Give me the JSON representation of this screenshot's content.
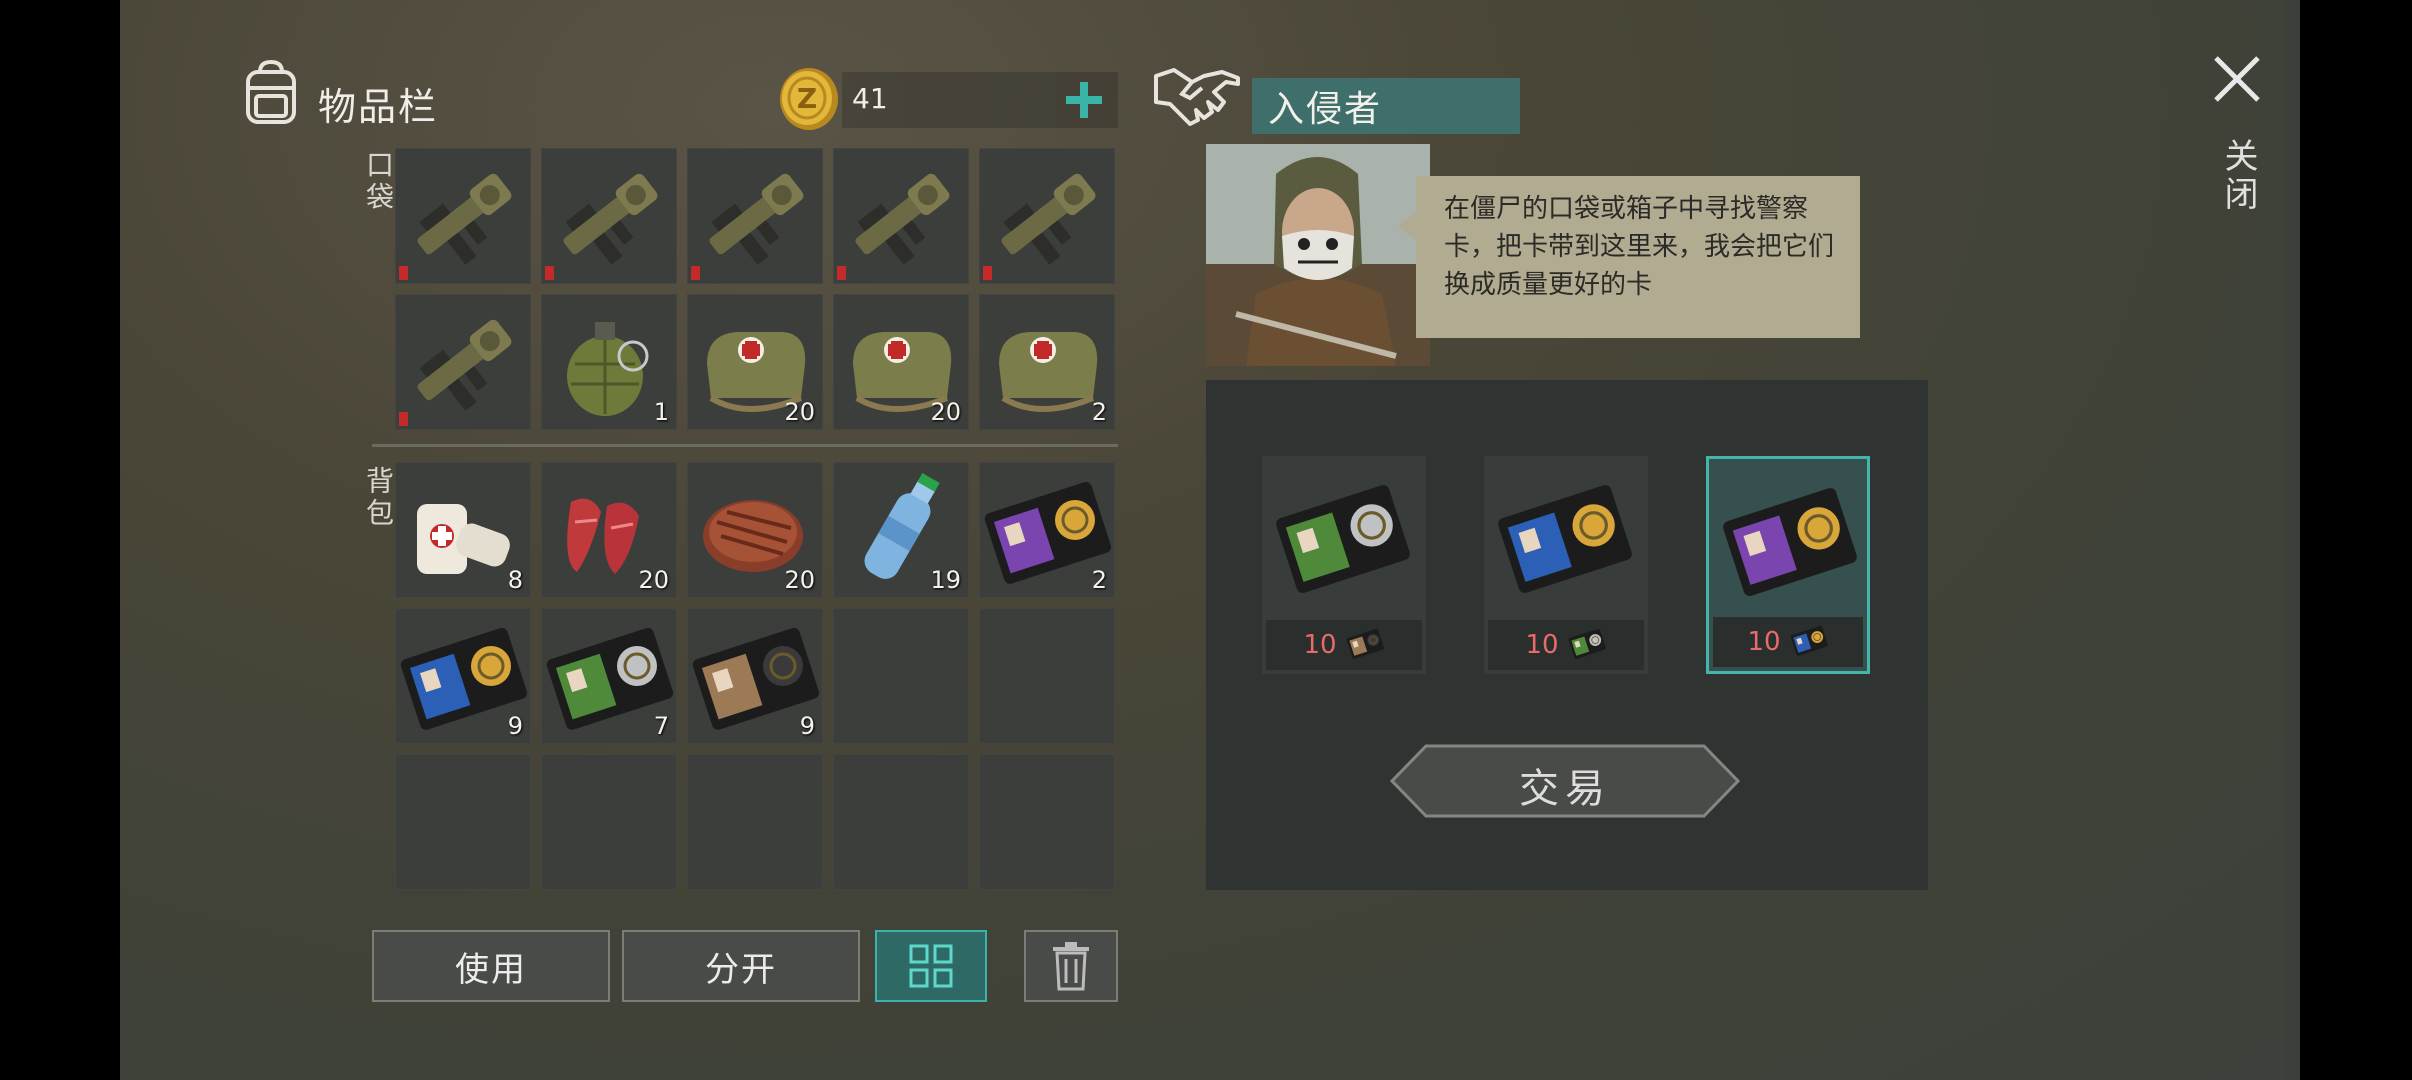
{
  "inventory": {
    "title": "物品栏",
    "coins": "41",
    "pocket_label": "口袋",
    "backpack_label": "背包",
    "pocket_slots": [
      {
        "item": "grenade-launcher",
        "qty": "",
        "damaged": true
      },
      {
        "item": "grenade-launcher",
        "qty": "",
        "damaged": true
      },
      {
        "item": "grenade-launcher",
        "qty": "",
        "damaged": true
      },
      {
        "item": "grenade-launcher",
        "qty": "",
        "damaged": true
      },
      {
        "item": "grenade-launcher",
        "qty": "",
        "damaged": true
      },
      {
        "item": "grenade-launcher",
        "qty": "",
        "damaged": true
      },
      {
        "item": "frag-grenade",
        "qty": "1",
        "damaged": false
      },
      {
        "item": "medkit-bag",
        "qty": "20",
        "damaged": false
      },
      {
        "item": "medkit-bag",
        "qty": "20",
        "damaged": false
      },
      {
        "item": "medkit-bag",
        "qty": "2",
        "damaged": false
      }
    ],
    "backpack_slots": [
      {
        "item": "bandage",
        "qty": "8"
      },
      {
        "item": "raw-meat",
        "qty": "20"
      },
      {
        "item": "steak",
        "qty": "20"
      },
      {
        "item": "water-bottle",
        "qty": "19"
      },
      {
        "item": "police-card-purple",
        "qty": "2"
      },
      {
        "item": "police-card-blue",
        "qty": "9"
      },
      {
        "item": "police-card-green",
        "qty": "7"
      },
      {
        "item": "police-card-brown",
        "qty": "9"
      },
      {
        "item": "",
        "qty": ""
      },
      {
        "item": "",
        "qty": ""
      },
      {
        "item": "",
        "qty": ""
      },
      {
        "item": "",
        "qty": ""
      },
      {
        "item": "",
        "qty": ""
      },
      {
        "item": "",
        "qty": ""
      },
      {
        "item": "",
        "qty": ""
      }
    ],
    "buttons": {
      "use": "使用",
      "split": "分开"
    }
  },
  "trader": {
    "name": "入侵者",
    "speech": "在僵尸的口袋或箱子中寻找警察卡，把卡带到这里来，我会把它们换成质量更好的卡",
    "offers": [
      {
        "card": "police-card-green",
        "cost": "10",
        "cost_card": "police-card-brown",
        "selected": false
      },
      {
        "card": "police-card-blue",
        "cost": "10",
        "cost_card": "police-card-green",
        "selected": false
      },
      {
        "card": "police-card-purple",
        "cost": "10",
        "cost_card": "police-card-blue",
        "selected": true
      }
    ],
    "trade_label": "交易"
  },
  "close_label": "关闭",
  "colors": {
    "accent": "#3ab3aa",
    "cost_text": "#e86a6a",
    "speech_bg": "#b1ab91"
  }
}
